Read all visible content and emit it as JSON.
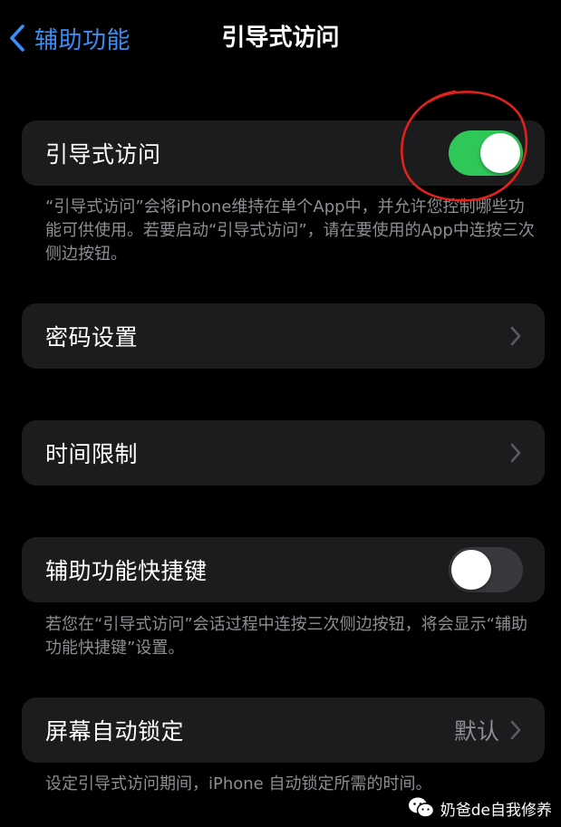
{
  "nav": {
    "back_label": "辅助功能",
    "title": "引导式访问"
  },
  "guided_access": {
    "label": "引导式访问",
    "enabled": true,
    "footer": "“引导式访问”会将iPhone维持在单个App中，并允许您控制哪些功能可供使用。若要启动“引导式访问”，请在要使用的App中连按三次侧边按钮。"
  },
  "passcode_settings": {
    "label": "密码设置"
  },
  "time_limits": {
    "label": "时间限制"
  },
  "accessibility_shortcut": {
    "label": "辅助功能快捷键",
    "enabled": false,
    "footer": "若您在“引导式访问”会话过程中连按三次侧边按钮，将会显示“辅助功能快捷键”设置。"
  },
  "auto_lock": {
    "label": "屏幕自动锁定",
    "value": "默认",
    "footer": "设定引导式访问期间，iPhone 自动锁定所需的时间。"
  },
  "watermark": {
    "text": "奶爸de自我修养",
    "icon": "wechat-icon"
  },
  "colors": {
    "accent": "#3a8ef6",
    "toggle_on": "#30c759",
    "toggle_off": "#39393d",
    "cell_background": "#1c1c1e",
    "annotation": "#e0221c"
  }
}
